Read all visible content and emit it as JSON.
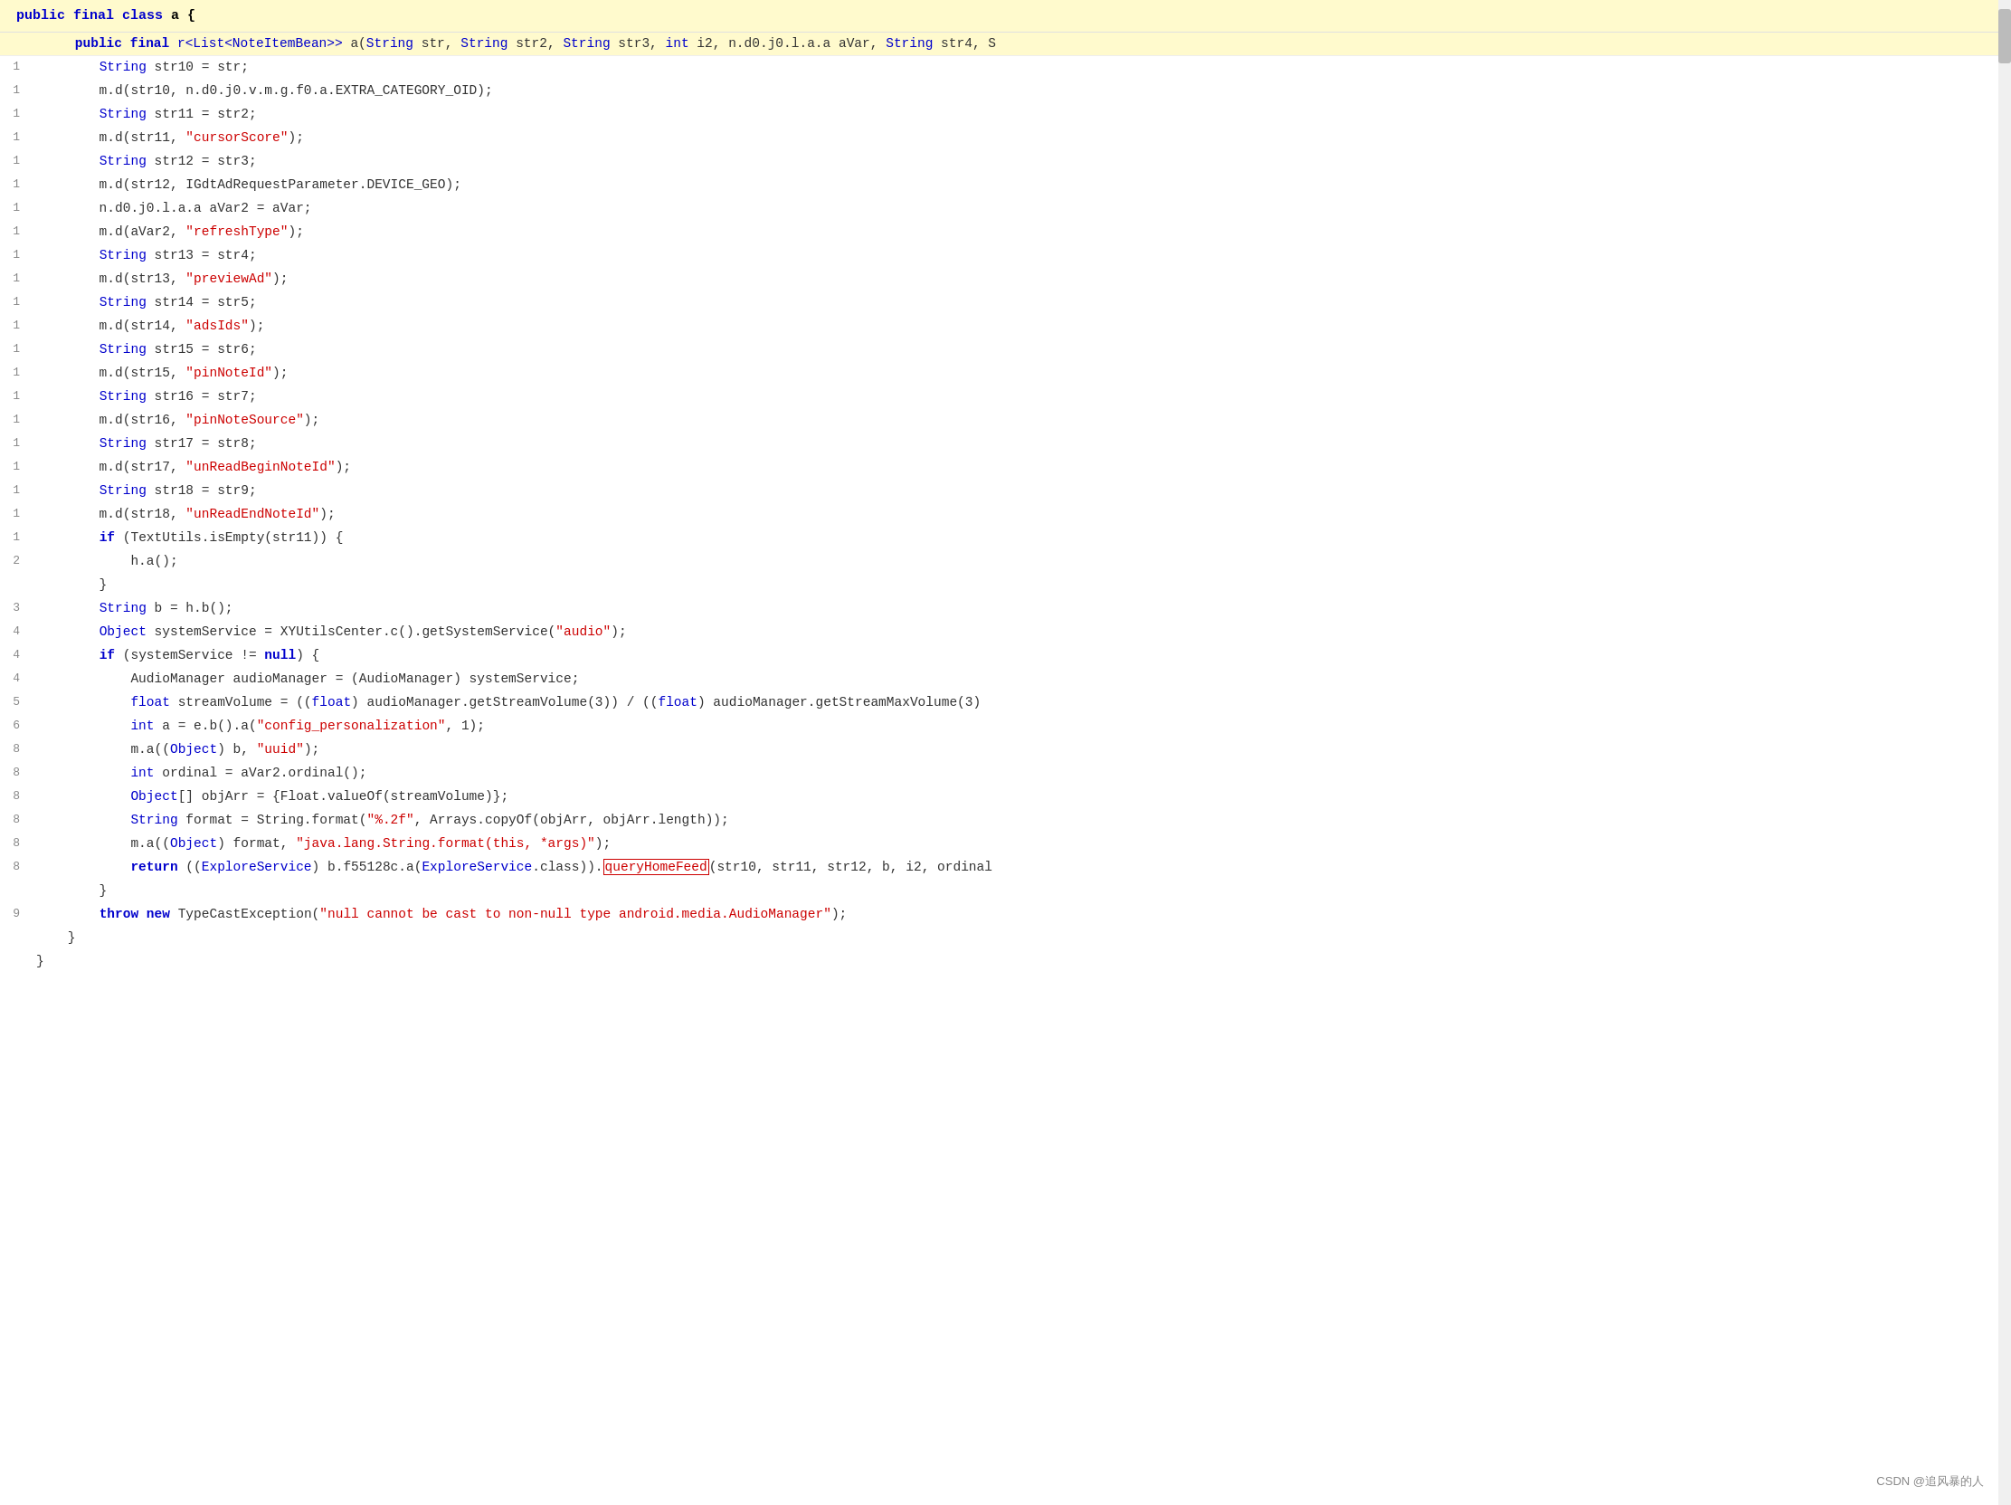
{
  "header": {
    "line": "public final class a {"
  },
  "subheader": {
    "line": "    public final r<List<NoteItemBean>> a(String str, String str2, String str3, int i2, n.d0.j0.l.a.a aVar, String str4, S"
  },
  "watermark": "CSDN @追风暴的人",
  "lines": [
    {
      "num": "1",
      "content": "String str10 = str;",
      "indent": 3
    },
    {
      "num": "1",
      "content": "m.d(str10, n.d0.j0.v.m.g.f0.a.EXTRA_CATEGORY_OID);",
      "indent": 3
    },
    {
      "num": "1",
      "content": "String str11 = str2;",
      "indent": 3
    },
    {
      "num": "1",
      "content": "m.d(str11, \"cursorScore\");",
      "indent": 3
    },
    {
      "num": "1",
      "content": "String str12 = str3;",
      "indent": 3
    },
    {
      "num": "1",
      "content": "m.d(str12, IGdtAdRequestParameter.DEVICE_GEO);",
      "indent": 3
    },
    {
      "num": "1",
      "content": "n.d0.j0.l.a.a aVar2 = aVar;",
      "indent": 3
    },
    {
      "num": "1",
      "content": "m.d(aVar2, \"refreshType\");",
      "indent": 3
    },
    {
      "num": "1",
      "content": "String str13 = str4;",
      "indent": 3
    },
    {
      "num": "1",
      "content": "m.d(str13, \"previewAd\");",
      "indent": 3
    },
    {
      "num": "1",
      "content": "String str14 = str5;",
      "indent": 3
    },
    {
      "num": "1",
      "content": "m.d(str14, \"adsIds\");",
      "indent": 3
    },
    {
      "num": "1",
      "content": "String str15 = str6;",
      "indent": 3
    },
    {
      "num": "1",
      "content": "m.d(str15, \"pinNoteId\");",
      "indent": 3
    },
    {
      "num": "1",
      "content": "String str16 = str7;",
      "indent": 3
    },
    {
      "num": "1",
      "content": "m.d(str16, \"pinNoteSource\");",
      "indent": 3
    },
    {
      "num": "1",
      "content": "String str17 = str8;",
      "indent": 3
    },
    {
      "num": "1",
      "content": "m.d(str17, \"unReadBeginNoteId\");",
      "indent": 3
    },
    {
      "num": "1",
      "content": "String str18 = str9;",
      "indent": 3
    },
    {
      "num": "1",
      "content": "m.d(str18, \"unReadEndNoteId\");",
      "indent": 3
    },
    {
      "num": "1",
      "content": "if (TextUtils.isEmpty(str11)) {",
      "indent": 3
    },
    {
      "num": "2",
      "content": "h.a();",
      "indent": 4
    },
    {
      "num": "",
      "content": "}",
      "indent": 3
    },
    {
      "num": "3",
      "content": "String b = h.b();",
      "indent": 3
    },
    {
      "num": "4",
      "content": "Object systemService = XYUtilsCenter.c().getSystemService(\"audio\");",
      "indent": 3
    },
    {
      "num": "4",
      "content": "if (systemService != null) {",
      "indent": 3
    },
    {
      "num": "4",
      "content": "AudioManager audioManager = (AudioManager) systemService;",
      "indent": 4
    },
    {
      "num": "5",
      "content": "float streamVolume = ((float) audioManager.getStreamVolume(3)) / ((float) audioManager.getStreamMaxVolume(3)",
      "indent": 4
    },
    {
      "num": "6",
      "content": "int a = e.b().a(\"config_personalization\", 1);",
      "indent": 4
    },
    {
      "num": "8",
      "content": "m.a((Object) b, \"uuid\");",
      "indent": 4
    },
    {
      "num": "8",
      "content": "int ordinal = aVar2.ordinal();",
      "indent": 4
    },
    {
      "num": "8",
      "content": "Object[] objArr = {Float.valueOf(streamVolume)};",
      "indent": 4
    },
    {
      "num": "8",
      "content": "String format = String.format(\"%.2f\", Arrays.copyOf(objArr, objArr.length));",
      "indent": 4
    },
    {
      "num": "8",
      "content": "m.a((Object) format, \"java.lang.String.format(this, *args)\");",
      "indent": 4
    },
    {
      "num": "8",
      "content": "return ((ExploreService) b.f55128c.a(ExploreService.class)).queryHomeFeed(str10, str11, str12, b, i2, ordinal",
      "indent": 4,
      "special": "return"
    },
    {
      "num": "",
      "content": "}",
      "indent": 3
    },
    {
      "num": "9",
      "content": "throw new TypeCastException(\"null cannot be cast to non-null type android.media.AudioManager\");",
      "indent": 3,
      "special": "throw"
    },
    {
      "num": "",
      "content": "}",
      "indent": 2
    },
    {
      "num": "",
      "content": "}",
      "indent": 0
    }
  ]
}
